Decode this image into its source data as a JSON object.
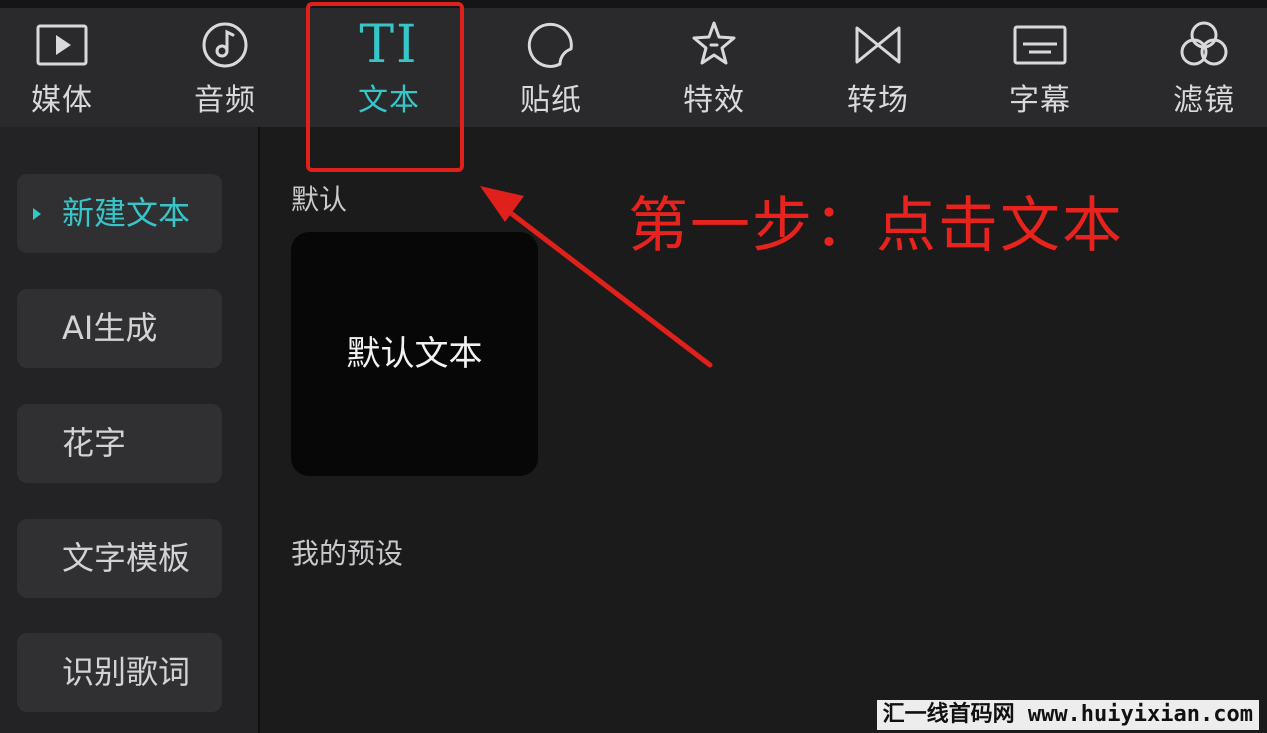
{
  "toolbar": {
    "tabs": [
      {
        "id": "media",
        "label": "媒体",
        "icon": "media-icon"
      },
      {
        "id": "audio",
        "label": "音频",
        "icon": "audio-icon"
      },
      {
        "id": "text",
        "label": "文本",
        "icon": "text-icon",
        "icon_glyph": "TI",
        "active": true
      },
      {
        "id": "sticker",
        "label": "贴纸",
        "icon": "sticker-icon"
      },
      {
        "id": "effects",
        "label": "特效",
        "icon": "effects-icon"
      },
      {
        "id": "transition",
        "label": "转场",
        "icon": "transition-icon"
      },
      {
        "id": "subtitle",
        "label": "字幕",
        "icon": "subtitle-icon"
      },
      {
        "id": "filter",
        "label": "滤镜",
        "icon": "filter-icon"
      }
    ]
  },
  "sidebar": {
    "items": [
      {
        "label": "新建文本",
        "active": true
      },
      {
        "label": "AI生成"
      },
      {
        "label": "花字"
      },
      {
        "label": "文字模板"
      },
      {
        "label": "识别歌词"
      }
    ]
  },
  "main": {
    "default_section": {
      "title": "默认",
      "preset_label": "默认文本"
    },
    "my_presets_section": {
      "title": "我的预设"
    }
  },
  "annotation": {
    "text": "第一步：点击文本",
    "color": "#e8231d"
  },
  "watermark": {
    "text": "汇一线首码网 www.huiyixian.com"
  },
  "colors": {
    "accent": "#36c6c9",
    "background": "#1b1b1c",
    "toolbar_bg": "#2a2a2c",
    "sidebar_bg": "#232325",
    "card_bg": "#070707",
    "annotation_red": "#e0201b"
  }
}
